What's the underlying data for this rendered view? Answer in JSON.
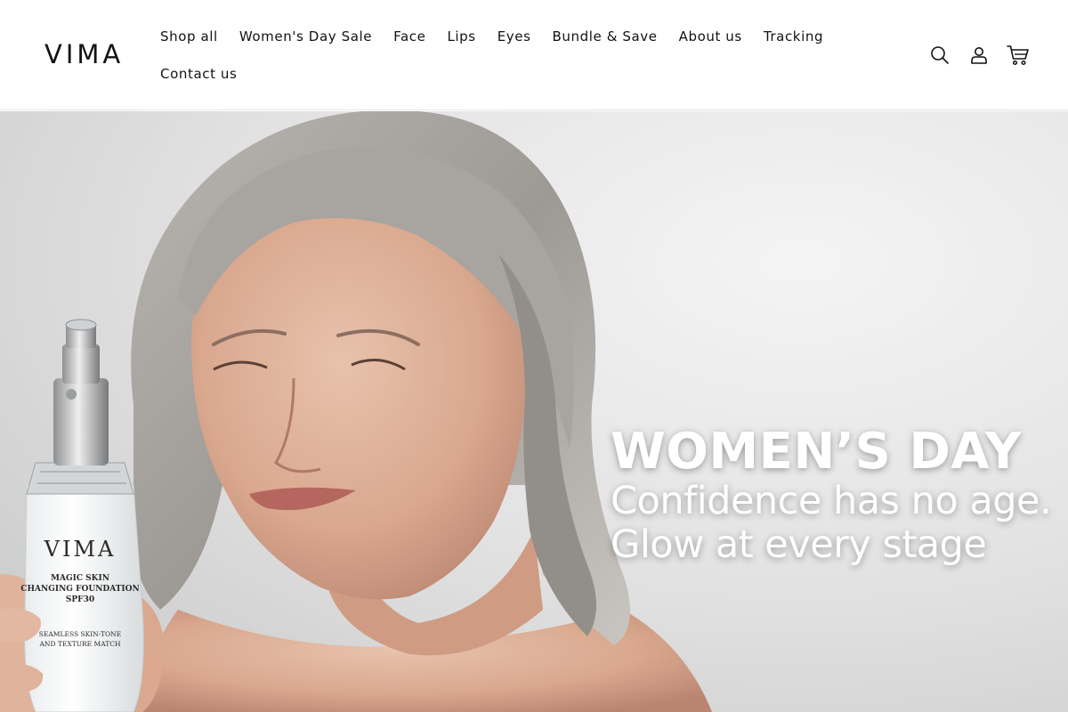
{
  "header": {
    "logo": "VIMA",
    "nav": [
      {
        "label": "Shop all"
      },
      {
        "label": "Women's Day Sale"
      },
      {
        "label": "Face"
      },
      {
        "label": "Lips"
      },
      {
        "label": "Eyes"
      },
      {
        "label": "Bundle & Save"
      },
      {
        "label": "About us"
      },
      {
        "label": "Tracking"
      },
      {
        "label": "Contact us"
      }
    ],
    "icons": [
      "search-icon",
      "account-icon",
      "cart-icon"
    ]
  },
  "hero": {
    "title": "WOMEN’S DAY",
    "subtitle_line1": "Confidence has no age.",
    "subtitle_line2": "Glow at every stage",
    "product": {
      "brand": "VIMA",
      "name_line1": "MAGIC SKIN",
      "name_line2": "CHANGING FOUNDATION",
      "name_line3": "SPF30",
      "desc_line1": "SEAMLESS SKIN-TONE",
      "desc_line2": "AND TEXTURE MATCH"
    }
  },
  "colors": {
    "text": "#121212",
    "hero_bg": "#e4e4e4",
    "hero_text": "#ffffff",
    "divider": "#e6e6e6"
  }
}
